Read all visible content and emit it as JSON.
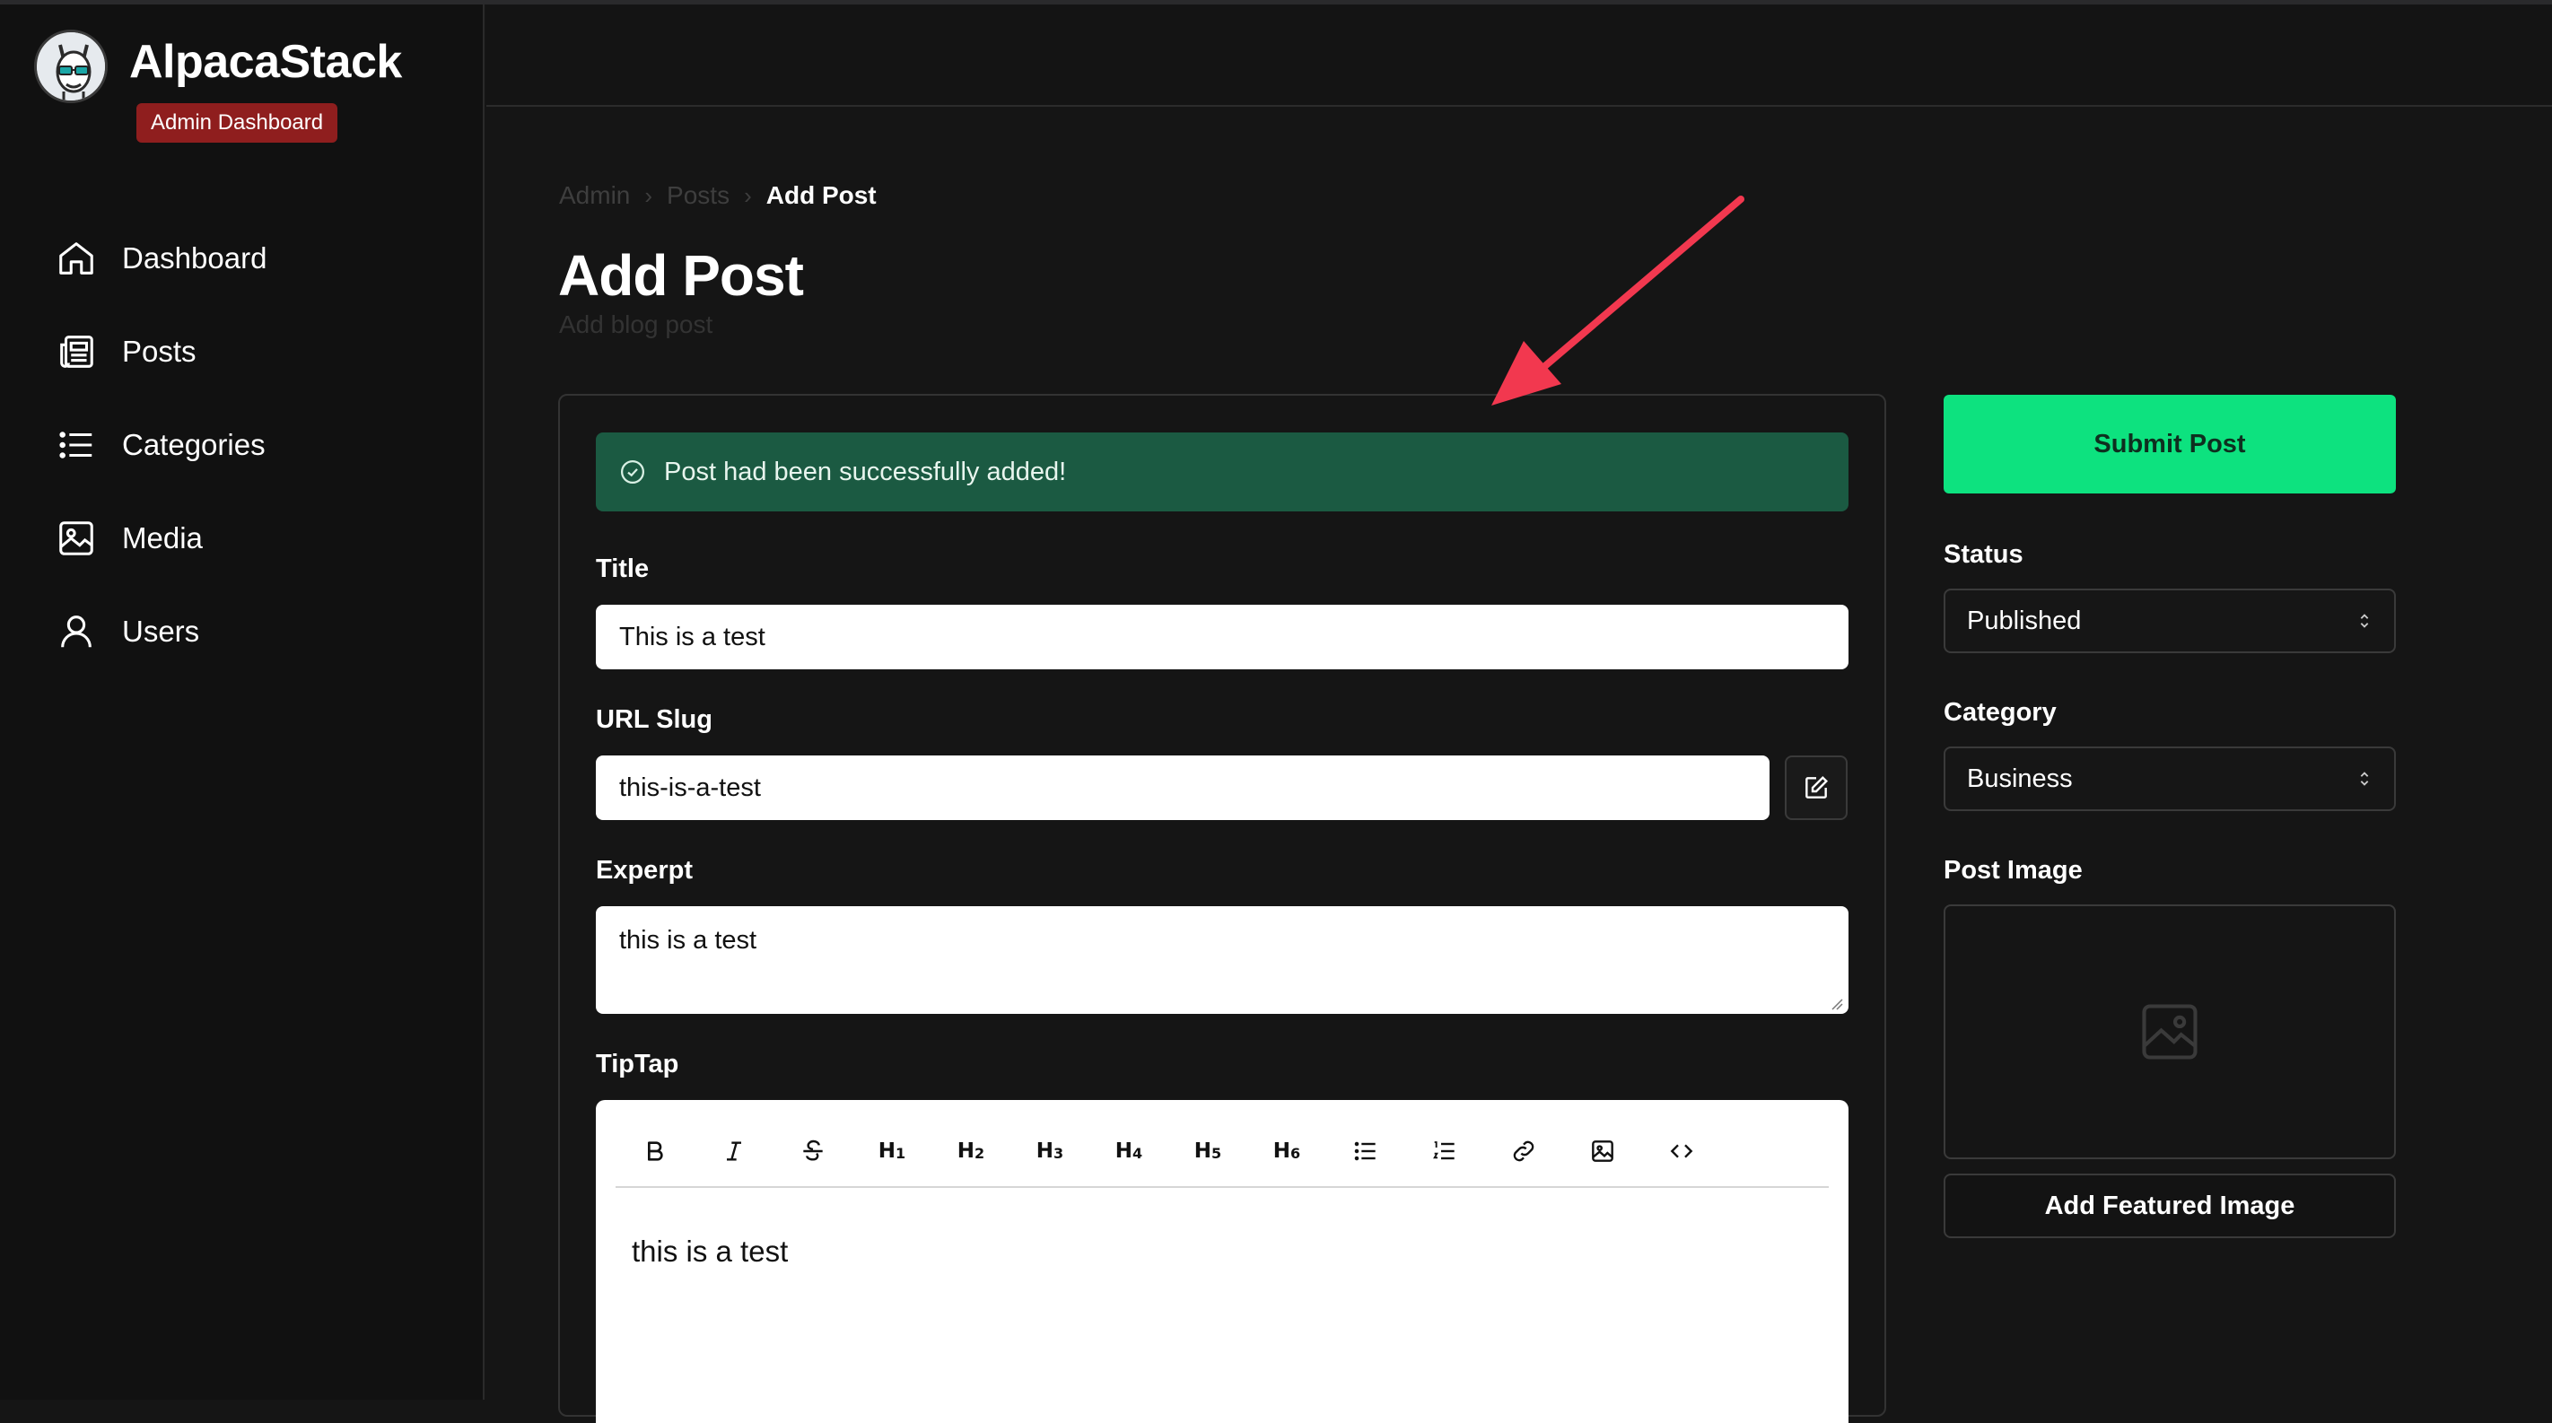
{
  "app": {
    "brand": "AlpacaStack",
    "badge": "Admin Dashboard"
  },
  "sidebar": {
    "items": [
      {
        "label": "Dashboard",
        "icon": "home-icon"
      },
      {
        "label": "Posts",
        "icon": "newspaper-icon"
      },
      {
        "label": "Categories",
        "icon": "list-icon"
      },
      {
        "label": "Media",
        "icon": "image-icon"
      },
      {
        "label": "Users",
        "icon": "user-icon"
      }
    ]
  },
  "breadcrumb": {
    "items": [
      "Admin",
      "Posts"
    ],
    "current": "Add Post"
  },
  "page": {
    "title": "Add Post",
    "subtitle": "Add blog post"
  },
  "alert": {
    "text": "Post had been successfully added!",
    "icon": "check-circle-icon"
  },
  "form": {
    "title_label": "Title",
    "title_value": "This is a test",
    "slug_label": "URL Slug",
    "slug_value": "this-is-a-test",
    "excerpt_label": "Experpt",
    "excerpt_value": "this is a test",
    "editor_label": "TipTap",
    "editor_content": "this is a test"
  },
  "toolbar": {
    "buttons": [
      "bold-icon",
      "italic-icon",
      "strikethrough-icon",
      "heading-1",
      "heading-2",
      "heading-3",
      "heading-4",
      "heading-5",
      "heading-6",
      "bullet-list-icon",
      "ordered-list-icon",
      "link-icon",
      "image-icon",
      "code-icon"
    ],
    "headings": [
      {
        "letter": "H",
        "num": "1"
      },
      {
        "letter": "H",
        "num": "2"
      },
      {
        "letter": "H",
        "num": "3"
      },
      {
        "letter": "H",
        "num": "4"
      },
      {
        "letter": "H",
        "num": "5"
      },
      {
        "letter": "H",
        "num": "6"
      }
    ]
  },
  "right_panel": {
    "submit_label": "Submit Post",
    "status_label": "Status",
    "status_value": "Published",
    "category_label": "Category",
    "category_value": "Business",
    "post_image_label": "Post Image",
    "add_image_label": "Add Featured Image"
  },
  "colors": {
    "accent_green": "#0de27f",
    "alert_bg": "#1b5a42",
    "badge_red": "#8f1e1e",
    "annotation_arrow": "#f2384f"
  }
}
